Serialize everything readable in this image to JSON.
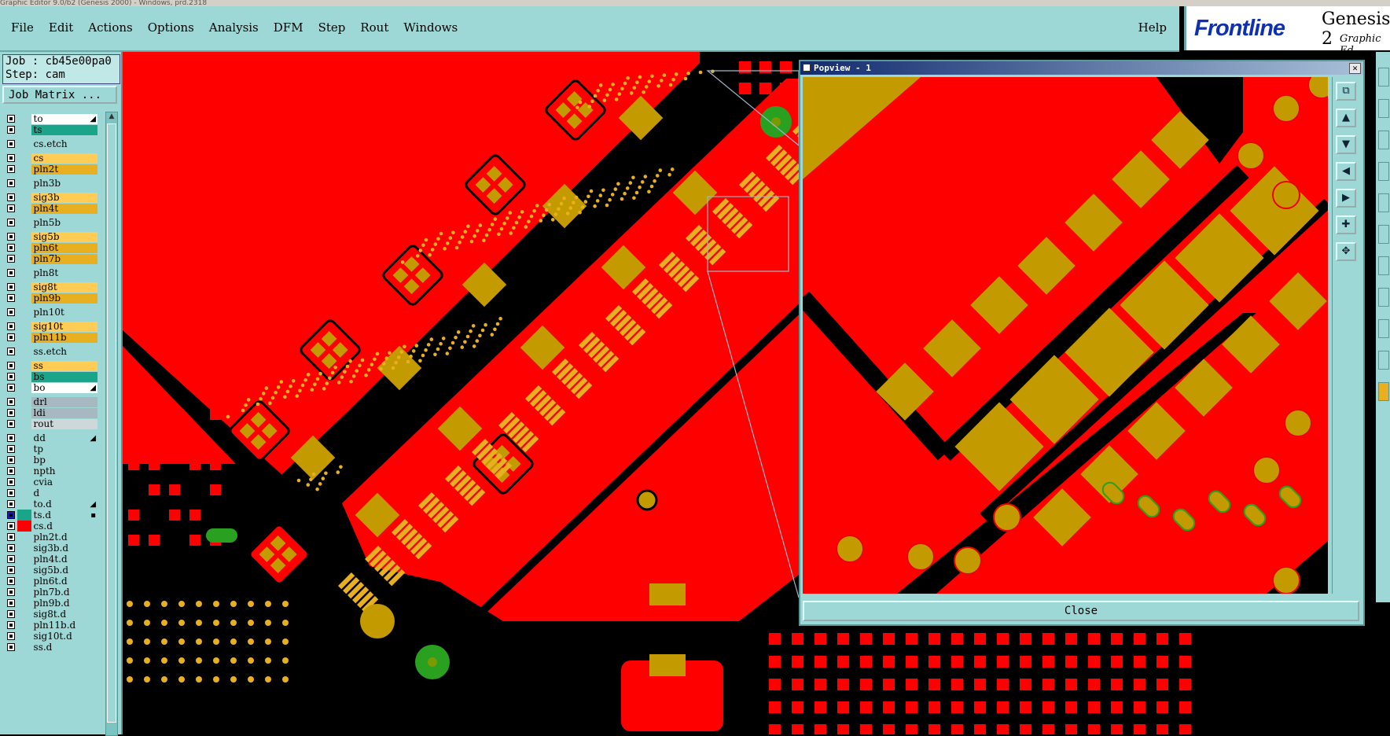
{
  "window_title": "Graphic Editor 9.0/b2 (Genesis 2000) - Windows, prd.2318",
  "menu": [
    "File",
    "Edit",
    "Actions",
    "Options",
    "Analysis",
    "DFM",
    "Step",
    "Rout",
    "Windows"
  ],
  "help_label": "Help",
  "brand": {
    "logo": "Frontline",
    "product": "Genesis 2",
    "subtitle": "Graphic Ed"
  },
  "job": {
    "job_line": "Job : cb45e00pa0",
    "step_line": "Step: cam",
    "matrix_button": "Job Matrix ..."
  },
  "layers": [
    {
      "name": "to",
      "color": "#ffffff",
      "mark": "◢",
      "group": 0
    },
    {
      "name": "ts",
      "color": "#1aa58a",
      "group": 0
    },
    {
      "name": "cs.etch",
      "color": "#9ed8d6",
      "group": 1
    },
    {
      "name": "cs",
      "color": "#ffcc55",
      "group": 2
    },
    {
      "name": "pln2t",
      "color": "#e8b020",
      "group": 2
    },
    {
      "name": "pln3b",
      "color": "#9ed8d6",
      "group": 3
    },
    {
      "name": "sig3b",
      "color": "#ffcc55",
      "group": 4
    },
    {
      "name": "pln4t",
      "color": "#e8b020",
      "group": 4
    },
    {
      "name": "pln5b",
      "color": "#9ed8d6",
      "group": 5
    },
    {
      "name": "sig5b",
      "color": "#ffcc55",
      "group": 6
    },
    {
      "name": "pln6t",
      "color": "#e8b020",
      "group": 6
    },
    {
      "name": "pln7b",
      "color": "#e8b020",
      "group": 6
    },
    {
      "name": "pln8t",
      "color": "#9ed8d6",
      "group": 7
    },
    {
      "name": "sig8t",
      "color": "#ffcc55",
      "group": 8
    },
    {
      "name": "pln9b",
      "color": "#e8b020",
      "group": 8
    },
    {
      "name": "pln10t",
      "color": "#9ed8d6",
      "group": 9
    },
    {
      "name": "sig10t",
      "color": "#ffcc55",
      "group": 10
    },
    {
      "name": "pln11b",
      "color": "#e8b020",
      "group": 10
    },
    {
      "name": "ss.etch",
      "color": "#9ed8d6",
      "group": 11
    },
    {
      "name": "ss",
      "color": "#ffcc55",
      "group": 12
    },
    {
      "name": "bs",
      "color": "#1aa58a",
      "group": 12
    },
    {
      "name": "bo",
      "color": "#ffffff",
      "mark": "◢",
      "group": 12
    },
    {
      "name": "drl",
      "color": "#a8b8c0",
      "group": 13
    },
    {
      "name": "ldi",
      "color": "#a8b8c0",
      "group": 13
    },
    {
      "name": "rout",
      "color": "#cfd8d8",
      "group": 13
    },
    {
      "name": "dd",
      "color": "#9ed8d6",
      "mark": "◢",
      "group": 14
    },
    {
      "name": "tp",
      "color": "#9ed8d6",
      "group": 14
    },
    {
      "name": "bp",
      "color": "#9ed8d6",
      "group": 14
    },
    {
      "name": "npth",
      "color": "#9ed8d6",
      "group": 14
    },
    {
      "name": "cvia",
      "color": "#9ed8d6",
      "group": 14
    },
    {
      "name": "d",
      "color": "#9ed8d6",
      "group": 14
    },
    {
      "name": "to.d",
      "color": "#9ed8d6",
      "mark": "◢",
      "group": 14
    },
    {
      "name": "ts.d",
      "color": "#9ed8d6",
      "mark": "▪",
      "group": 14,
      "active": true,
      "swatch": "#1aa58a"
    },
    {
      "name": "cs.d",
      "color": "#9ed8d6",
      "group": 14,
      "swatch": "#ff0000"
    },
    {
      "name": "pln2t.d",
      "color": "#9ed8d6",
      "group": 14
    },
    {
      "name": "sig3b.d",
      "color": "#9ed8d6",
      "group": 14
    },
    {
      "name": "pln4t.d",
      "color": "#9ed8d6",
      "group": 14
    },
    {
      "name": "sig5b.d",
      "color": "#9ed8d6",
      "group": 14
    },
    {
      "name": "pln6t.d",
      "color": "#9ed8d6",
      "group": 14
    },
    {
      "name": "pln7b.d",
      "color": "#9ed8d6",
      "group": 14
    },
    {
      "name": "pln9b.d",
      "color": "#9ed8d6",
      "group": 14
    },
    {
      "name": "sig8t.d",
      "color": "#9ed8d6",
      "group": 14
    },
    {
      "name": "pln11b.d",
      "color": "#9ed8d6",
      "group": 14
    },
    {
      "name": "sig10t.d",
      "color": "#9ed8d6",
      "group": 14
    },
    {
      "name": "ss.d",
      "color": "#9ed8d6",
      "group": 14
    }
  ],
  "popview": {
    "title": "Popview - 1",
    "close_label": "Close"
  },
  "colors": {
    "copper": "#ff0000",
    "pad": "#c39a00",
    "pad_outline": "#e8b020",
    "green": "#2aa020",
    "bg": "#000000",
    "ui": "#9ed8d6"
  }
}
